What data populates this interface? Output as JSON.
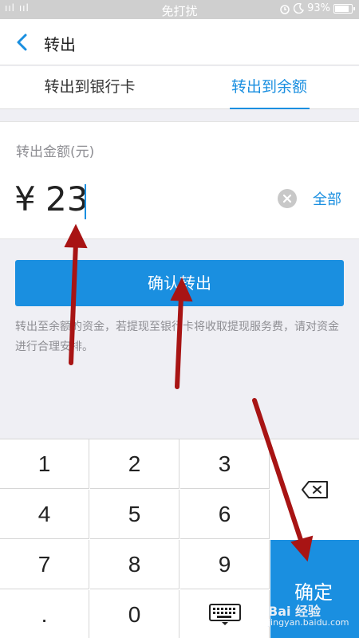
{
  "status_bar": {
    "signal": "ııl ııl",
    "center_text": "免打扰",
    "battery": "93%"
  },
  "nav": {
    "title": "转出"
  },
  "tabs": [
    {
      "label": "转出到银行卡",
      "active": false
    },
    {
      "label": "转出到余额",
      "active": true
    }
  ],
  "amount": {
    "label": "转出金额(元)",
    "currency_symbol": "¥",
    "value": "23",
    "all_label": "全部"
  },
  "confirm_button": {
    "label": "确认转出"
  },
  "notice": "转出至余额的资金，若提现至银行卡将收取提现服务费，请对资金进行合理安排。",
  "keypad": {
    "keys": [
      "1",
      "2",
      "3",
      "4",
      "5",
      "6",
      "7",
      "8",
      "9",
      ".",
      "0"
    ],
    "ok_label": "确定"
  },
  "watermark": {
    "brand": "Bai  经验",
    "url": "jingyan.baidu.com"
  },
  "colors": {
    "accent": "#1a8fe0",
    "annotation_arrow": "#a81414"
  }
}
